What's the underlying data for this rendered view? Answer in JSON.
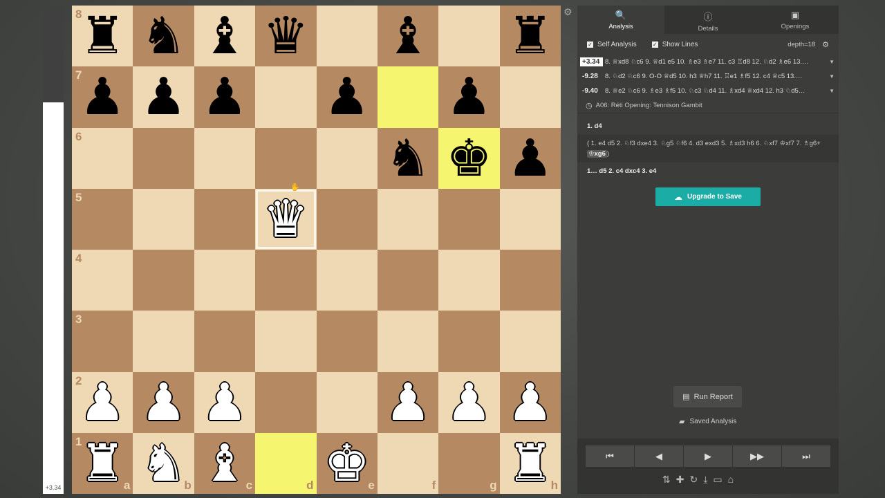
{
  "eval_bar": {
    "score": "+3.34",
    "white_fraction": 0.8
  },
  "board": {
    "ranks": [
      "8",
      "7",
      "6",
      "5",
      "4",
      "3",
      "2",
      "1"
    ],
    "files": [
      "a",
      "b",
      "c",
      "d",
      "e",
      "f",
      "g",
      "h"
    ],
    "colors": {
      "light": "#eed9b4",
      "dark": "#b58a63",
      "highlight": "#f6f56f"
    },
    "position": [
      [
        "br",
        "bn",
        "bb",
        "bq",
        "",
        "bb",
        "",
        "br"
      ],
      [
        "bp",
        "bp",
        "bp",
        "",
        "bp",
        "",
        "bp",
        ""
      ],
      [
        "",
        "",
        "",
        "",
        "",
        "bn",
        "bk",
        "bp"
      ],
      [
        "",
        "",
        "",
        "wq",
        "",
        "",
        "",
        ""
      ],
      [
        "",
        "",
        "",
        "",
        "",
        "",
        "",
        ""
      ],
      [
        "",
        "",
        "",
        "",
        "",
        "",
        "",
        ""
      ],
      [
        "wp",
        "wp",
        "wp",
        "",
        "",
        "wp",
        "wp",
        "wp"
      ],
      [
        "wr",
        "wn",
        "wb",
        "",
        "wk",
        "",
        "",
        "wr"
      ]
    ],
    "highlighted_squares": [
      "f7",
      "g6",
      "d1"
    ],
    "hover_square": "d5"
  },
  "tabs": [
    {
      "label": "Analysis",
      "icon": "magnify-icon",
      "active": true
    },
    {
      "label": "Details",
      "icon": "info-icon",
      "active": false
    },
    {
      "label": "Openings",
      "icon": "book-icon",
      "active": false
    }
  ],
  "options": {
    "self_analysis": "Self Analysis",
    "show_lines": "Show Lines",
    "depth": "depth=18"
  },
  "engine_lines": [
    {
      "score": "+3.34",
      "moves": "8. ♕xd8 ♘c6 9. ♕d1 e5 10. ♗e3 ♗e7 11. c3 ♖d8 12. ♘d2 ♗e6 13.…"
    },
    {
      "score": "-9.28",
      "moves": "8. ♘d2 ♘c6 9. O-O ♕d5 10. h3 ♕h7 11. ♖e1 ♗f5 12. c4 ♕c5 13.…"
    },
    {
      "score": "-9.40",
      "moves": "8. ♕e2 ♘c6 9. ♗e3 ♗f5 10. ♘c3 ♘d4 11. ♗xd4 ♕xd4 12. h3 ♘d5…"
    }
  ],
  "opening": "A06: Réti Opening: Tennison Gambit",
  "moves": {
    "main1": "1. d4",
    "variation": "( 1. e4 d5 2. ♘f3 dxe4 3. ♘g5 ♘f6 4. d3 exd3 5. ♗xd3 h6 6. ♘xf7 ♔xf7 7. ♗g6+",
    "variation_current": "♔xg6",
    "variation_close": ")",
    "main2": "1… d5 2. c4 dxc4 3. e4"
  },
  "buttons": {
    "upgrade": "Upgrade to Save",
    "run_report": "Run Report",
    "saved_analysis": "Saved Analysis",
    "nav": [
      "⏮",
      "◀",
      "▶",
      "▶▶",
      "⏭"
    ]
  }
}
